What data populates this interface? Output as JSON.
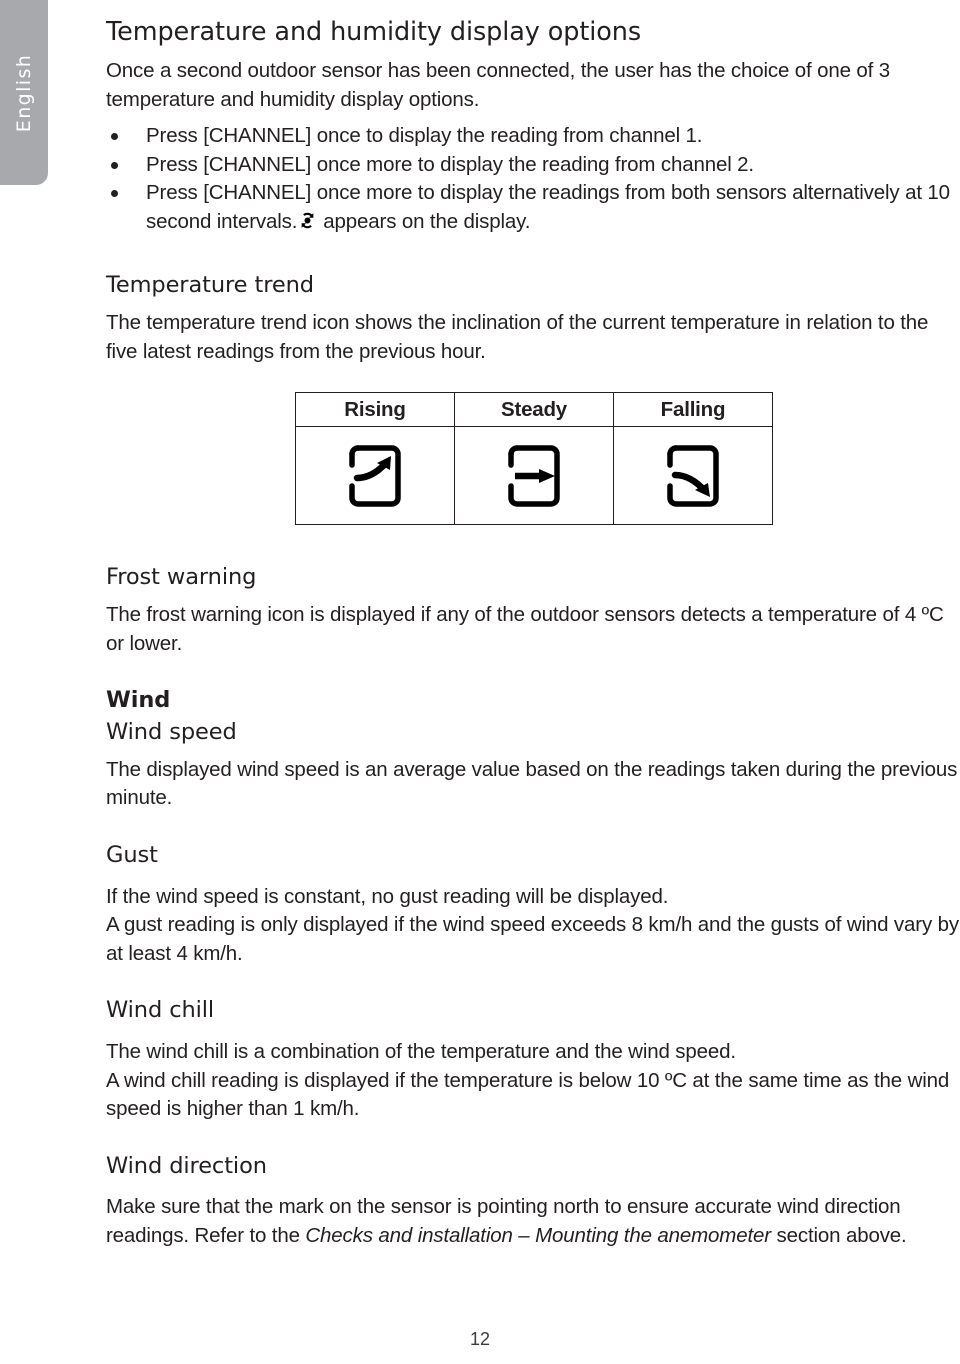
{
  "sidebar": {
    "language_tab": "English"
  },
  "page": {
    "number": "12"
  },
  "sections": {
    "display_options": {
      "heading": "Temperature and humidity display options",
      "intro": "Once a second outdoor sensor has been connected, the user has the choice of one of 3 temperature and humidity display options.",
      "bullets": [
        "Press [CHANNEL] once to display the reading from channel 1.",
        "Press [CHANNEL] once more to display the reading from channel 2.",
        "Press [CHANNEL] once more to display the readings from both sensors alternatively at 10 second intervals."
      ],
      "bullet3_suffix": "appears on the display.",
      "bullet3_icon": "sync-refresh-icon"
    },
    "temperature_trend": {
      "heading": "Temperature trend",
      "body": "The temperature trend icon shows the inclination of the current temperature in relation to the five latest readings from the previous hour.",
      "table": {
        "headers": [
          "Rising",
          "Steady",
          "Falling"
        ],
        "icons": [
          "trend-rising-icon",
          "trend-steady-icon",
          "trend-falling-icon"
        ]
      }
    },
    "frost_warning": {
      "heading": "Frost warning",
      "body": "The frost warning icon is displayed if any of the outdoor sensors detects a temperature of 4 ºC or lower."
    },
    "wind": {
      "heading": "Wind",
      "wind_speed": {
        "heading": "Wind speed",
        "body": "The displayed wind speed is an average value based on the readings taken during the previous minute."
      },
      "gust": {
        "heading": "Gust",
        "body_line1": "If the wind speed is constant, no gust reading will be displayed.",
        "body_line2": "A gust reading is only displayed if the wind speed exceeds 8 km/h and the gusts of wind vary by at least 4 km/h."
      },
      "wind_chill": {
        "heading": "Wind chill",
        "body_line1": "The wind chill is a combination of the temperature and the wind speed.",
        "body_line2": "A wind chill reading is displayed if the temperature is below 10 ºC at the same time as the wind speed is higher than 1 km/h."
      },
      "wind_direction": {
        "heading": "Wind direction",
        "body_prefix": "Make sure that the mark on the sensor is pointing north to ensure accurate wind direction readings. Refer to the ",
        "body_italic": "Checks and installation – Mounting the anemometer",
        "body_suffix": " section above."
      }
    }
  },
  "colors": {
    "tab_gray": "#a7a9ac",
    "text": "#231f20",
    "page_background": "#ffffff"
  }
}
